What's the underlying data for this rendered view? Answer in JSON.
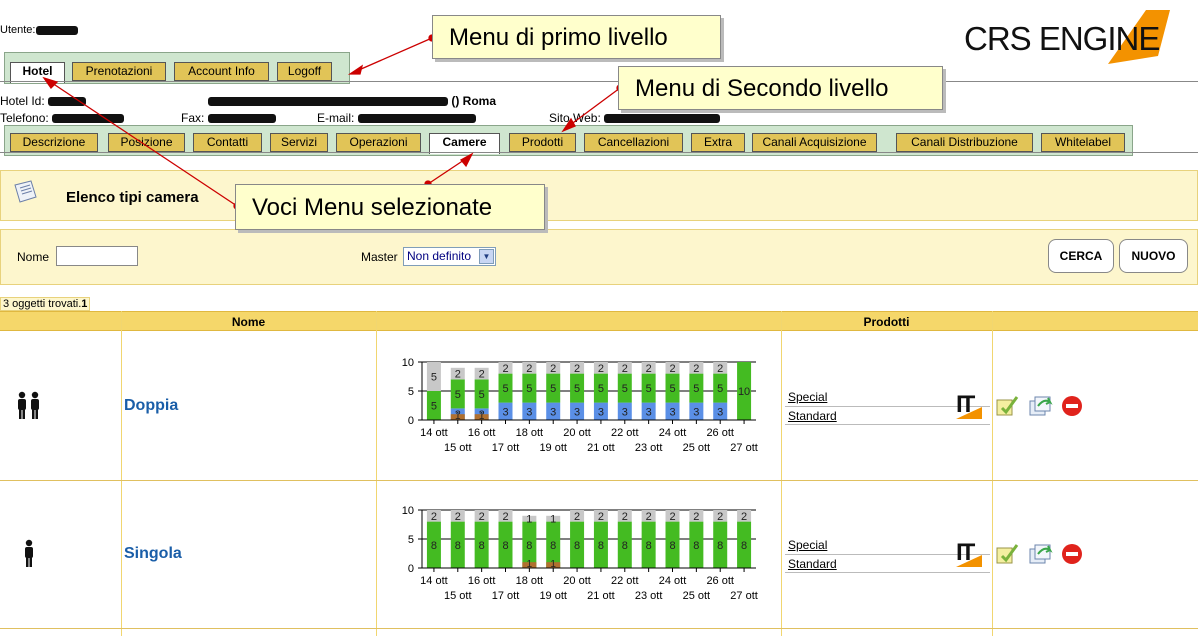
{
  "user": {
    "label": "Utente:"
  },
  "logo": {
    "text": "CRS ENGINE",
    "accent": "#f39200"
  },
  "menu1": {
    "tabs": [
      {
        "label": "Hotel",
        "selected": true
      },
      {
        "label": "Prenotazioni",
        "selected": false
      },
      {
        "label": "Account Info",
        "selected": false
      },
      {
        "label": "Logoff",
        "selected": false
      }
    ]
  },
  "hotel_info": {
    "hotel_id_label": "Hotel Id:",
    "hotel_name_suffix": "() Roma",
    "telefono_label": "Telefono:",
    "fax_label": "Fax:",
    "email_label": "E-mail:",
    "sito_label": "Sito Web:"
  },
  "menu2": {
    "tabs": [
      {
        "label": "Descrizione"
      },
      {
        "label": "Posizione"
      },
      {
        "label": "Contatti"
      },
      {
        "label": "Servizi"
      },
      {
        "label": "Operazioni"
      },
      {
        "label": "Camere",
        "selected": true
      },
      {
        "label": "Prodotti"
      },
      {
        "label": "Cancellazioni"
      },
      {
        "label": "Extra"
      },
      {
        "label": "Canali Acquisizione"
      },
      {
        "label": "Canali Distribuzione"
      },
      {
        "label": "Whitelabel"
      }
    ]
  },
  "section": {
    "title": "Elenco tipi camera"
  },
  "filter": {
    "nome_label": "Nome",
    "nome_value": "",
    "master_label": "Master",
    "master_selected": "Non definito",
    "search_button": "CERCA",
    "new_button": "NUOVO"
  },
  "results": {
    "count_text": "3 oggetti trovati.",
    "page": "1"
  },
  "table": {
    "headers": [
      "",
      "Nome",
      "",
      "Prodotti",
      ""
    ]
  },
  "rooms": [
    {
      "name": "Doppia",
      "icon": "two-persons-icon",
      "products": [
        "Special",
        "Standard"
      ],
      "chart": {
        "ymax": 10,
        "yticks": [
          0,
          5,
          10
        ],
        "xlabels_top": [
          "14 ott",
          "16 ott",
          "18 ott",
          "20 ott",
          "22 ott",
          "24 ott",
          "26 ott"
        ],
        "xlabels_bottom": [
          "15 ott",
          "17 ott",
          "19 ott",
          "21 ott",
          "23 ott",
          "25 ott",
          "27 ott"
        ],
        "bars": [
          {
            "green": 5,
            "grey": 5,
            "blue": 0,
            "brown": 0
          },
          {
            "green": 5,
            "grey": 2,
            "blue": 2,
            "brown": 1
          },
          {
            "green": 5,
            "grey": 2,
            "blue": 2,
            "brown": 1
          },
          {
            "green": 5,
            "grey": 2,
            "blue": 3,
            "brown": 0
          },
          {
            "green": 5,
            "grey": 2,
            "blue": 3,
            "brown": 0
          },
          {
            "green": 5,
            "grey": 2,
            "blue": 3,
            "brown": 0
          },
          {
            "green": 5,
            "grey": 2,
            "blue": 3,
            "brown": 0
          },
          {
            "green": 5,
            "grey": 2,
            "blue": 3,
            "brown": 0
          },
          {
            "green": 5,
            "grey": 2,
            "blue": 3,
            "brown": 0
          },
          {
            "green": 5,
            "grey": 2,
            "blue": 3,
            "brown": 0
          },
          {
            "green": 5,
            "grey": 2,
            "blue": 3,
            "brown": 0
          },
          {
            "green": 5,
            "grey": 2,
            "blue": 3,
            "brown": 0
          },
          {
            "green": 5,
            "grey": 2,
            "blue": 3,
            "brown": 0
          },
          {
            "green": 10,
            "grey": 0,
            "blue": 0,
            "brown": 0
          }
        ]
      }
    },
    {
      "name": "Singola",
      "icon": "single-person-icon",
      "products": [
        "Special",
        "Standard"
      ],
      "chart": {
        "ymax": 10,
        "yticks": [
          0,
          5,
          10
        ],
        "xlabels_top": [
          "14 ott",
          "16 ott",
          "18 ott",
          "20 ott",
          "22 ott",
          "24 ott",
          "26 ott"
        ],
        "xlabels_bottom": [
          "15 ott",
          "17 ott",
          "19 ott",
          "21 ott",
          "23 ott",
          "25 ott",
          "27 ott"
        ],
        "bars": [
          {
            "green": 8,
            "grey": 2,
            "blue": 0,
            "brown": 0
          },
          {
            "green": 8,
            "grey": 2,
            "blue": 0,
            "brown": 0
          },
          {
            "green": 8,
            "grey": 2,
            "blue": 0,
            "brown": 0
          },
          {
            "green": 8,
            "grey": 2,
            "blue": 0,
            "brown": 0
          },
          {
            "green": 8,
            "grey": 1,
            "blue": 0,
            "brown": 1
          },
          {
            "green": 8,
            "grey": 1,
            "blue": 0,
            "brown": 1
          },
          {
            "green": 8,
            "grey": 2,
            "blue": 0,
            "brown": 0
          },
          {
            "green": 8,
            "grey": 2,
            "blue": 0,
            "brown": 0
          },
          {
            "green": 8,
            "grey": 2,
            "blue": 0,
            "brown": 0
          },
          {
            "green": 8,
            "grey": 2,
            "blue": 0,
            "brown": 0
          },
          {
            "green": 8,
            "grey": 2,
            "blue": 0,
            "brown": 0
          },
          {
            "green": 8,
            "grey": 2,
            "blue": 0,
            "brown": 0
          },
          {
            "green": 8,
            "grey": 2,
            "blue": 0,
            "brown": 0
          },
          {
            "green": 8,
            "grey": 2,
            "blue": 0,
            "brown": 0
          }
        ]
      }
    }
  ],
  "product_badge": "IT",
  "row_actions": [
    "edit-icon",
    "copy-icon",
    "delete-icon"
  ],
  "callouts": {
    "menu1": "Menu di primo livello",
    "menu2": "Menu di Secondo livello",
    "selected": "Voci Menu selezionate"
  },
  "colors": {
    "green": "#44bb22",
    "blue": "#5a8fe6",
    "grey": "#c8c8c8",
    "brown": "#b07030",
    "tab": "#e1c457",
    "menu_bg": "#cfe6cf",
    "panel_bg": "#fdf6cd",
    "header_bg": "#f5d76a",
    "callout_bg": "#ffffcc",
    "arrow": "#cc0000"
  }
}
